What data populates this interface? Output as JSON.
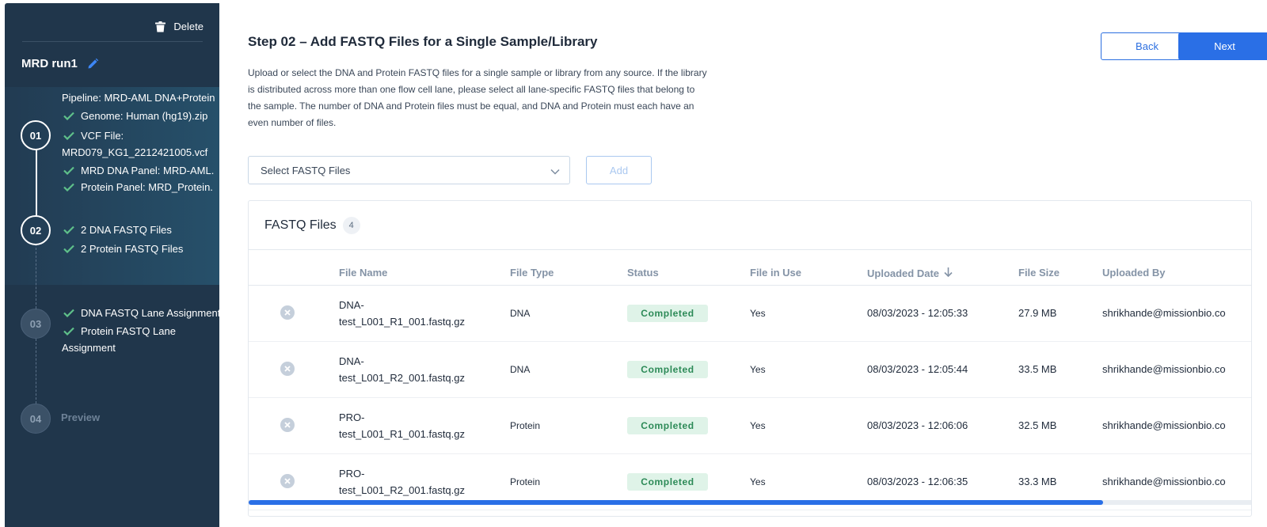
{
  "sidebar": {
    "delete_label": "Delete",
    "run_title": "MRD run1",
    "steps": [
      {
        "number": "01",
        "state": "done",
        "items": [
          {
            "text": "Pipeline: MRD-AML DNA+Protein",
            "checked": false
          },
          {
            "text": "Genome: Human (hg19).zip",
            "checked": true
          },
          {
            "text": "VCF File:",
            "checked": true
          },
          {
            "text": "MRD079_KG1_2212421005.vcf",
            "checked": false
          },
          {
            "text": "MRD DNA Panel: MRD-AML.",
            "checked": true
          },
          {
            "text": "Protein Panel: MRD_Protein.",
            "checked": true
          }
        ]
      },
      {
        "number": "02",
        "state": "done",
        "items": [
          {
            "text": "2 DNA FASTQ Files",
            "checked": true
          },
          {
            "text": "2 Protein FASTQ Files",
            "checked": true
          }
        ]
      },
      {
        "number": "03",
        "state": "todo",
        "items": [
          {
            "text": "DNA FASTQ Lane Assignment",
            "checked": true
          },
          {
            "text": "Protein FASTQ Lane",
            "checked": true
          },
          {
            "text": "Assignment",
            "checked": false
          }
        ]
      },
      {
        "number": "04",
        "state": "todo",
        "label": "Preview"
      }
    ]
  },
  "main": {
    "title": "Step 02 – Add FASTQ Files for a Single Sample/Library",
    "description_lines": [
      "Upload or select the DNA and Protein FASTQ files for a single sample or library from any source. If the library",
      "is distributed across more than one flow cell lane, please select all lane-specific FASTQ files that belong to",
      "the sample. The number of DNA and Protein files must be equal, and DNA and Protein must each have an",
      "even number of files."
    ],
    "back_label": "Back",
    "next_label": "Next",
    "select_placeholder": "Select FASTQ Files",
    "add_label": "Add",
    "panel_title": "FASTQ Files",
    "file_count": "4",
    "scroll_position": 0.87,
    "columns": [
      "File Name",
      "File Type",
      "Status",
      "File in Use",
      "Uploaded Date",
      "File Size",
      "Uploaded By"
    ],
    "rows": [
      {
        "name_line1": "DNA-",
        "name_line2": "test_L001_R1_001.fastq.gz",
        "type": "DNA",
        "status": "Completed",
        "in_use": "Yes",
        "date": "08/03/2023 - 12:05:33",
        "size": "27.9 MB",
        "by": "shrikhande@missionbio.co"
      },
      {
        "name_line1": "DNA-",
        "name_line2": "test_L001_R2_001.fastq.gz",
        "type": "DNA",
        "status": "Completed",
        "in_use": "Yes",
        "date": "08/03/2023 - 12:05:44",
        "size": "33.5 MB",
        "by": "shrikhande@missionbio.co"
      },
      {
        "name_line1": "PRO-",
        "name_line2": "test_L001_R1_001.fastq.gz",
        "type": "Protein",
        "status": "Completed",
        "in_use": "Yes",
        "date": "08/03/2023 - 12:06:06",
        "size": "32.5 MB",
        "by": "shrikhande@missionbio.co"
      },
      {
        "name_line1": "PRO-",
        "name_line2": "test_L001_R2_001.fastq.gz",
        "type": "Protein",
        "status": "Completed",
        "in_use": "Yes",
        "date": "08/03/2023 - 12:06:35",
        "size": "33.3 MB",
        "by": "shrikhande@missionbio.co"
      }
    ]
  },
  "colors": {
    "sidebar_bg": "#20364b",
    "accent": "#2a6fe6",
    "check": "#5fc18a",
    "status_bg": "#dff3e8",
    "status_text": "#2c8a57"
  },
  "icons": {
    "delete": "trash-icon",
    "edit": "pencil-icon",
    "check": "check-icon",
    "dropdown": "chevron-down-icon",
    "remove": "remove-circle-icon",
    "sort": "arrow-down-icon"
  }
}
